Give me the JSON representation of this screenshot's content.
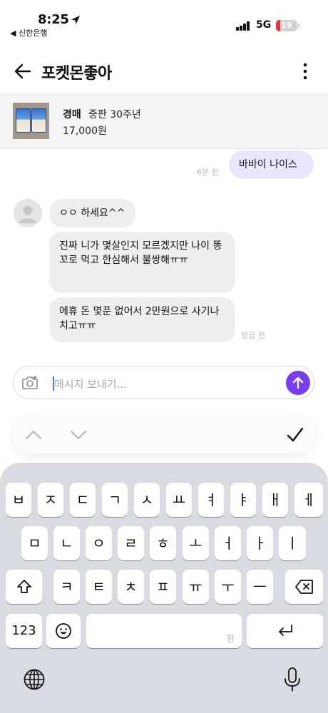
{
  "status_bar": {
    "time": "8:25",
    "back_app": "◀ 신한은행",
    "network": "5G",
    "battery": "19",
    "battery_level": 0.19
  },
  "header": {
    "title": "포켓몬좋아"
  },
  "product": {
    "status": "경매",
    "name": "중판 30주년",
    "price": "17,000원"
  },
  "messages": {
    "outgoing": [
      {
        "text": "바바이 나이스",
        "time": "6분 전"
      }
    ],
    "incoming": [
      {
        "text": "ㅇㅇ 하세요^^"
      },
      {
        "text": "진짜 니가 몇살인지 모르겠지만 나이 똥꼬로 먹고 한심해서 불쌍해ㅠㅠ"
      },
      {
        "text": "에휴 돈 몇푼 없어서 2만원으로 사기나 치고ㅠㅠ"
      }
    ],
    "incoming_time": "방금 전"
  },
  "input": {
    "placeholder": "메시지 보내기..."
  },
  "keyboard": {
    "row1": [
      "ㅂ",
      "ㅈ",
      "ㄷ",
      "ㄱ",
      "ㅅ",
      "ㅛ",
      "ㅕ",
      "ㅑ",
      "ㅐ",
      "ㅔ"
    ],
    "row2": [
      "ㅁ",
      "ㄴ",
      "ㅇ",
      "ㄹ",
      "ㅎ",
      "ㅗ",
      "ㅓ",
      "ㅏ",
      "ㅣ"
    ],
    "row3": [
      "ㅋ",
      "ㅌ",
      "ㅊ",
      "ㅍ",
      "ㅠ",
      "ㅜ",
      "ㅡ"
    ],
    "numbers_label": "123",
    "space_hint": "한"
  },
  "colors": {
    "accent": "#7a3cf2",
    "outgoing_bubble": "#e9e6fe",
    "incoming_bubble": "#eeeef1",
    "keyboard_bg": "#d9dbe2"
  }
}
